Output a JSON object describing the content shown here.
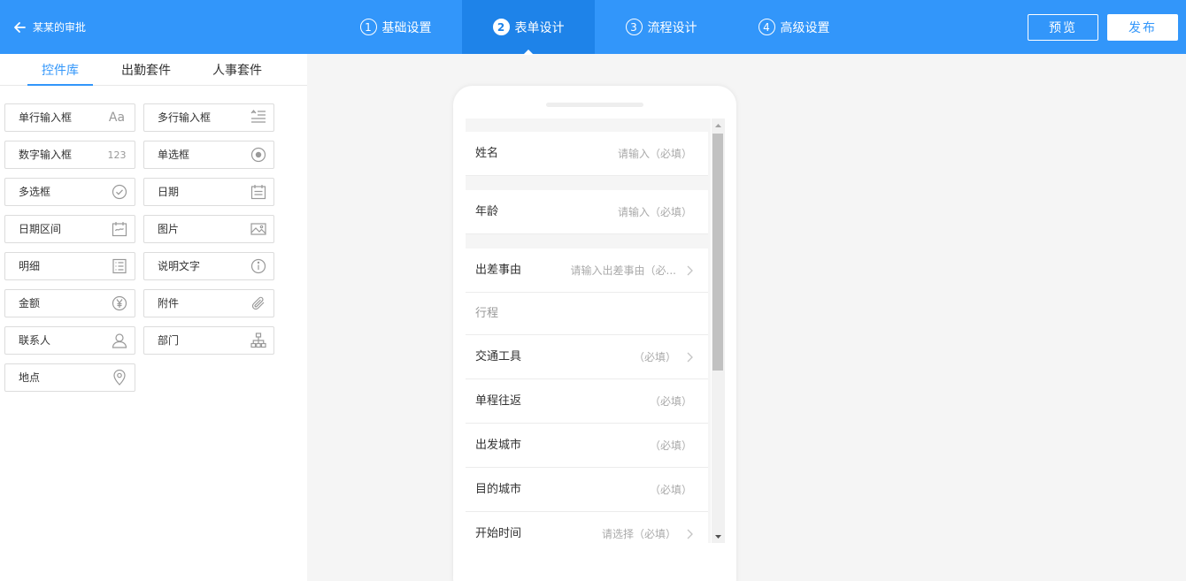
{
  "header": {
    "back_label": "某某的审批",
    "steps": [
      {
        "num": "1",
        "label": "基础设置"
      },
      {
        "num": "2",
        "label": "表单设计"
      },
      {
        "num": "3",
        "label": "流程设计"
      },
      {
        "num": "4",
        "label": "高级设置"
      }
    ],
    "preview_label": "预览",
    "publish_label": "发布"
  },
  "left_panel": {
    "tabs": [
      "控件库",
      "出勤套件",
      "人事套件"
    ],
    "controls": [
      {
        "label": "单行输入框",
        "icon": "text-aa-icon",
        "icon_text": "Aa"
      },
      {
        "label": "多行输入框",
        "icon": "multiline-text-icon"
      },
      {
        "label": "数字输入框",
        "icon": "number-123-icon",
        "icon_text": "123"
      },
      {
        "label": "单选框",
        "icon": "radio-icon"
      },
      {
        "label": "多选框",
        "icon": "checkbox-check-icon"
      },
      {
        "label": "日期",
        "icon": "calendar-icon"
      },
      {
        "label": "日期区间",
        "icon": "calendar-range-icon"
      },
      {
        "label": "图片",
        "icon": "image-icon"
      },
      {
        "label": "明细",
        "icon": "detail-list-icon"
      },
      {
        "label": "说明文字",
        "icon": "info-icon"
      },
      {
        "label": "金额",
        "icon": "yen-icon"
      },
      {
        "label": "附件",
        "icon": "paperclip-icon"
      },
      {
        "label": "联系人",
        "icon": "user-icon"
      },
      {
        "label": "部门",
        "icon": "org-chart-icon"
      },
      {
        "label": "地点",
        "icon": "location-pin-icon"
      }
    ]
  },
  "form": {
    "fields": [
      {
        "label": "姓名",
        "placeholder": "请输入（必填）"
      },
      {
        "label": "年龄",
        "placeholder": "请输入（必填）"
      },
      {
        "label": "出差事由",
        "placeholder": "请输入出差事由（必..."
      },
      {
        "label": "行程",
        "placeholder": ""
      },
      {
        "label": "交通工具",
        "placeholder": "（必填）"
      },
      {
        "label": "单程往返",
        "placeholder": "（必填）"
      },
      {
        "label": "出发城市",
        "placeholder": "（必填）"
      },
      {
        "label": "目的城市",
        "placeholder": "（必填）"
      },
      {
        "label": "开始时间",
        "placeholder": "请选择（必填）"
      }
    ]
  },
  "colors": {
    "primary": "#3296fa",
    "active_step": "#1e83e9"
  }
}
